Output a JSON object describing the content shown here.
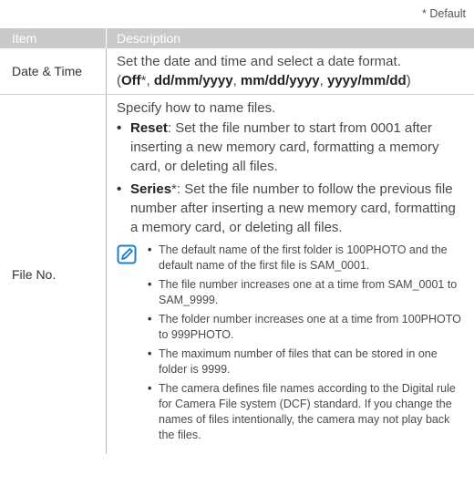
{
  "default_note": "* Default",
  "header": {
    "item": "Item",
    "description": "Description"
  },
  "date_time": {
    "item": "Date & Time",
    "desc_line": "Set the date and time and select a date format.",
    "paren_open": "(",
    "fmt_off": "Off",
    "fmt_off_mark": "*, ",
    "fmt_dd": "dd/mm/yyyy",
    "sep1": ", ",
    "fmt_mm": "mm/dd/yyyy",
    "sep2": ", ",
    "fmt_yy": "yyyy/mm/dd",
    "paren_close": ")"
  },
  "file_no": {
    "item": "File No.",
    "intro": "Specify how to name files.",
    "bullets": [
      {
        "label": "Reset",
        "text": ": Set the file number to start from 0001 after inserting a new memory card, formatting a memory card, or deleting all files."
      },
      {
        "label": "Series",
        "mark": "*",
        "text": ": Set the file number to follow the previous file number after inserting a new memory card, formatting a memory card, or deleting all files."
      }
    ],
    "notes": [
      "The default name of the first folder is 100PHOTO and the default name of the first file is SAM_0001.",
      "The file number increases one at a time from SAM_0001 to SAM_9999.",
      "The folder number increases one at a time from 100PHOTO to 999PHOTO.",
      "The maximum number of files that can be stored in one folder is 9999.",
      "The camera defines file names according to the Digital rule for Camera File system (DCF) standard. If you change the names of files intentionally, the camera may not play back the files."
    ]
  },
  "icons": {
    "note": "note-pencil-icon"
  },
  "colors": {
    "header_bg": "#c9c9c9",
    "icon_blue": "#1a7fc4"
  }
}
